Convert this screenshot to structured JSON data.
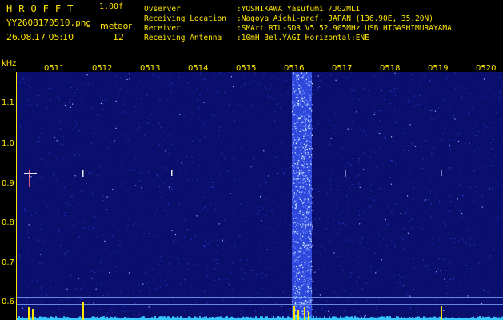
{
  "header": {
    "brand": "HROFFT",
    "version": "1.00f",
    "filename": "YY2608170510.png",
    "datetime": "26.08.17 05:10",
    "meteor_label": "meteor",
    "meteor_count": "12"
  },
  "station": {
    "observer_label": "Ovserver",
    "observer": ":YOSHIKAWA Yasufumi /JG2MLI",
    "location_label": "Receiving Location",
    "location": ":Nagoya Aichi-pref. JAPAN (136.90E, 35.20N)",
    "receiver_label": "Receiver",
    "receiver": ":SMArt RTL-SDR V5 52.905MHz USB HIGASHIMURAYAMA",
    "antenna_label": "Receiving Antenna",
    "antenna": ":10mH 3el.YAGI Horizontal:ENE"
  },
  "axis": {
    "unit": "kHz",
    "freq_ticks": [
      "1.1",
      "1.0",
      "0.9",
      "0.8",
      "0.7",
      "0.6"
    ],
    "time_ticks": [
      "0511",
      "0512",
      "0513",
      "0514",
      "0515",
      "0516",
      "0517",
      "0518",
      "0519",
      "0520"
    ]
  },
  "colors": {
    "background": "#000000",
    "text": "#ffe600",
    "noise_bg": "#0a0f6e",
    "signal": "#cfe3ff"
  }
}
